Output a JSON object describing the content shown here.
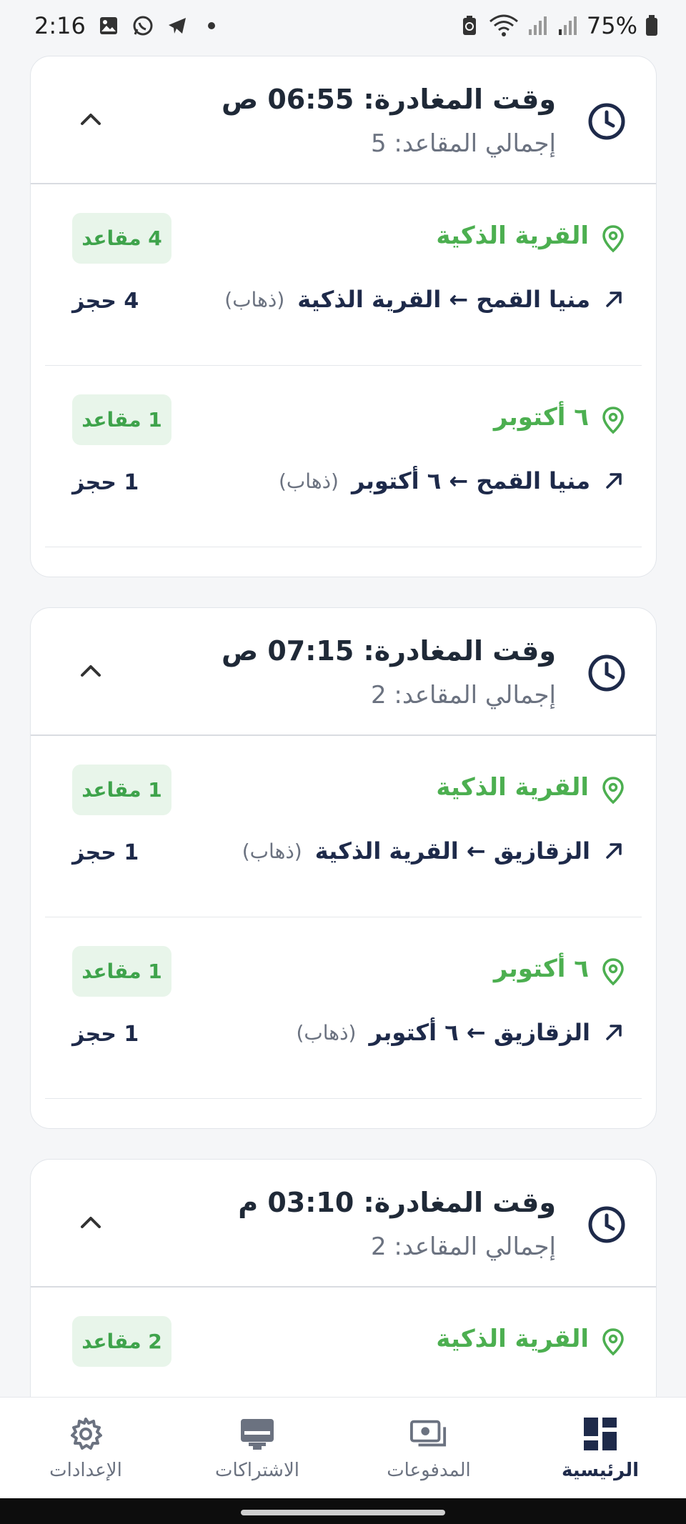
{
  "status": {
    "time": "2:16",
    "battery": "75%"
  },
  "trips": [
    {
      "departure": "وقت المغادرة: 06:55 ص",
      "total_seats": "إجمالي المقاعد: 5",
      "stops": [
        {
          "name": "القرية الذكية",
          "seats": "4 مقاعد",
          "route": "منيا القمح ← القرية الذكية",
          "direction": "(ذهاب)",
          "bookings": "4 حجز"
        },
        {
          "name": "٦ أكتوبر",
          "seats": "1 مقاعد",
          "route": "منيا القمح ← ٦ أكتوبر",
          "direction": "(ذهاب)",
          "bookings": "1 حجز"
        }
      ]
    },
    {
      "departure": "وقت المغادرة: 07:15 ص",
      "total_seats": "إجمالي المقاعد: 2",
      "stops": [
        {
          "name": "القرية الذكية",
          "seats": "1 مقاعد",
          "route": "الزقازيق ← القرية الذكية",
          "direction": "(ذهاب)",
          "bookings": "1 حجز"
        },
        {
          "name": "٦ أكتوبر",
          "seats": "1 مقاعد",
          "route": "الزقازيق ← ٦ أكتوبر",
          "direction": "(ذهاب)",
          "bookings": "1 حجز"
        }
      ]
    },
    {
      "departure": "وقت المغادرة: 03:10 م",
      "total_seats": "إجمالي المقاعد: 2",
      "stops": [
        {
          "name": "القرية الذكية",
          "seats": "2 مقاعد"
        }
      ]
    }
  ],
  "nav": {
    "settings": "الإعدادات",
    "subscriptions": "الاشتراكات",
    "payments": "المدفوعات",
    "home": "الرئيسية"
  },
  "colors": {
    "accent_green": "#4caf50",
    "navy": "#1e2a4a",
    "badge_bg": "#e8f5ea"
  }
}
